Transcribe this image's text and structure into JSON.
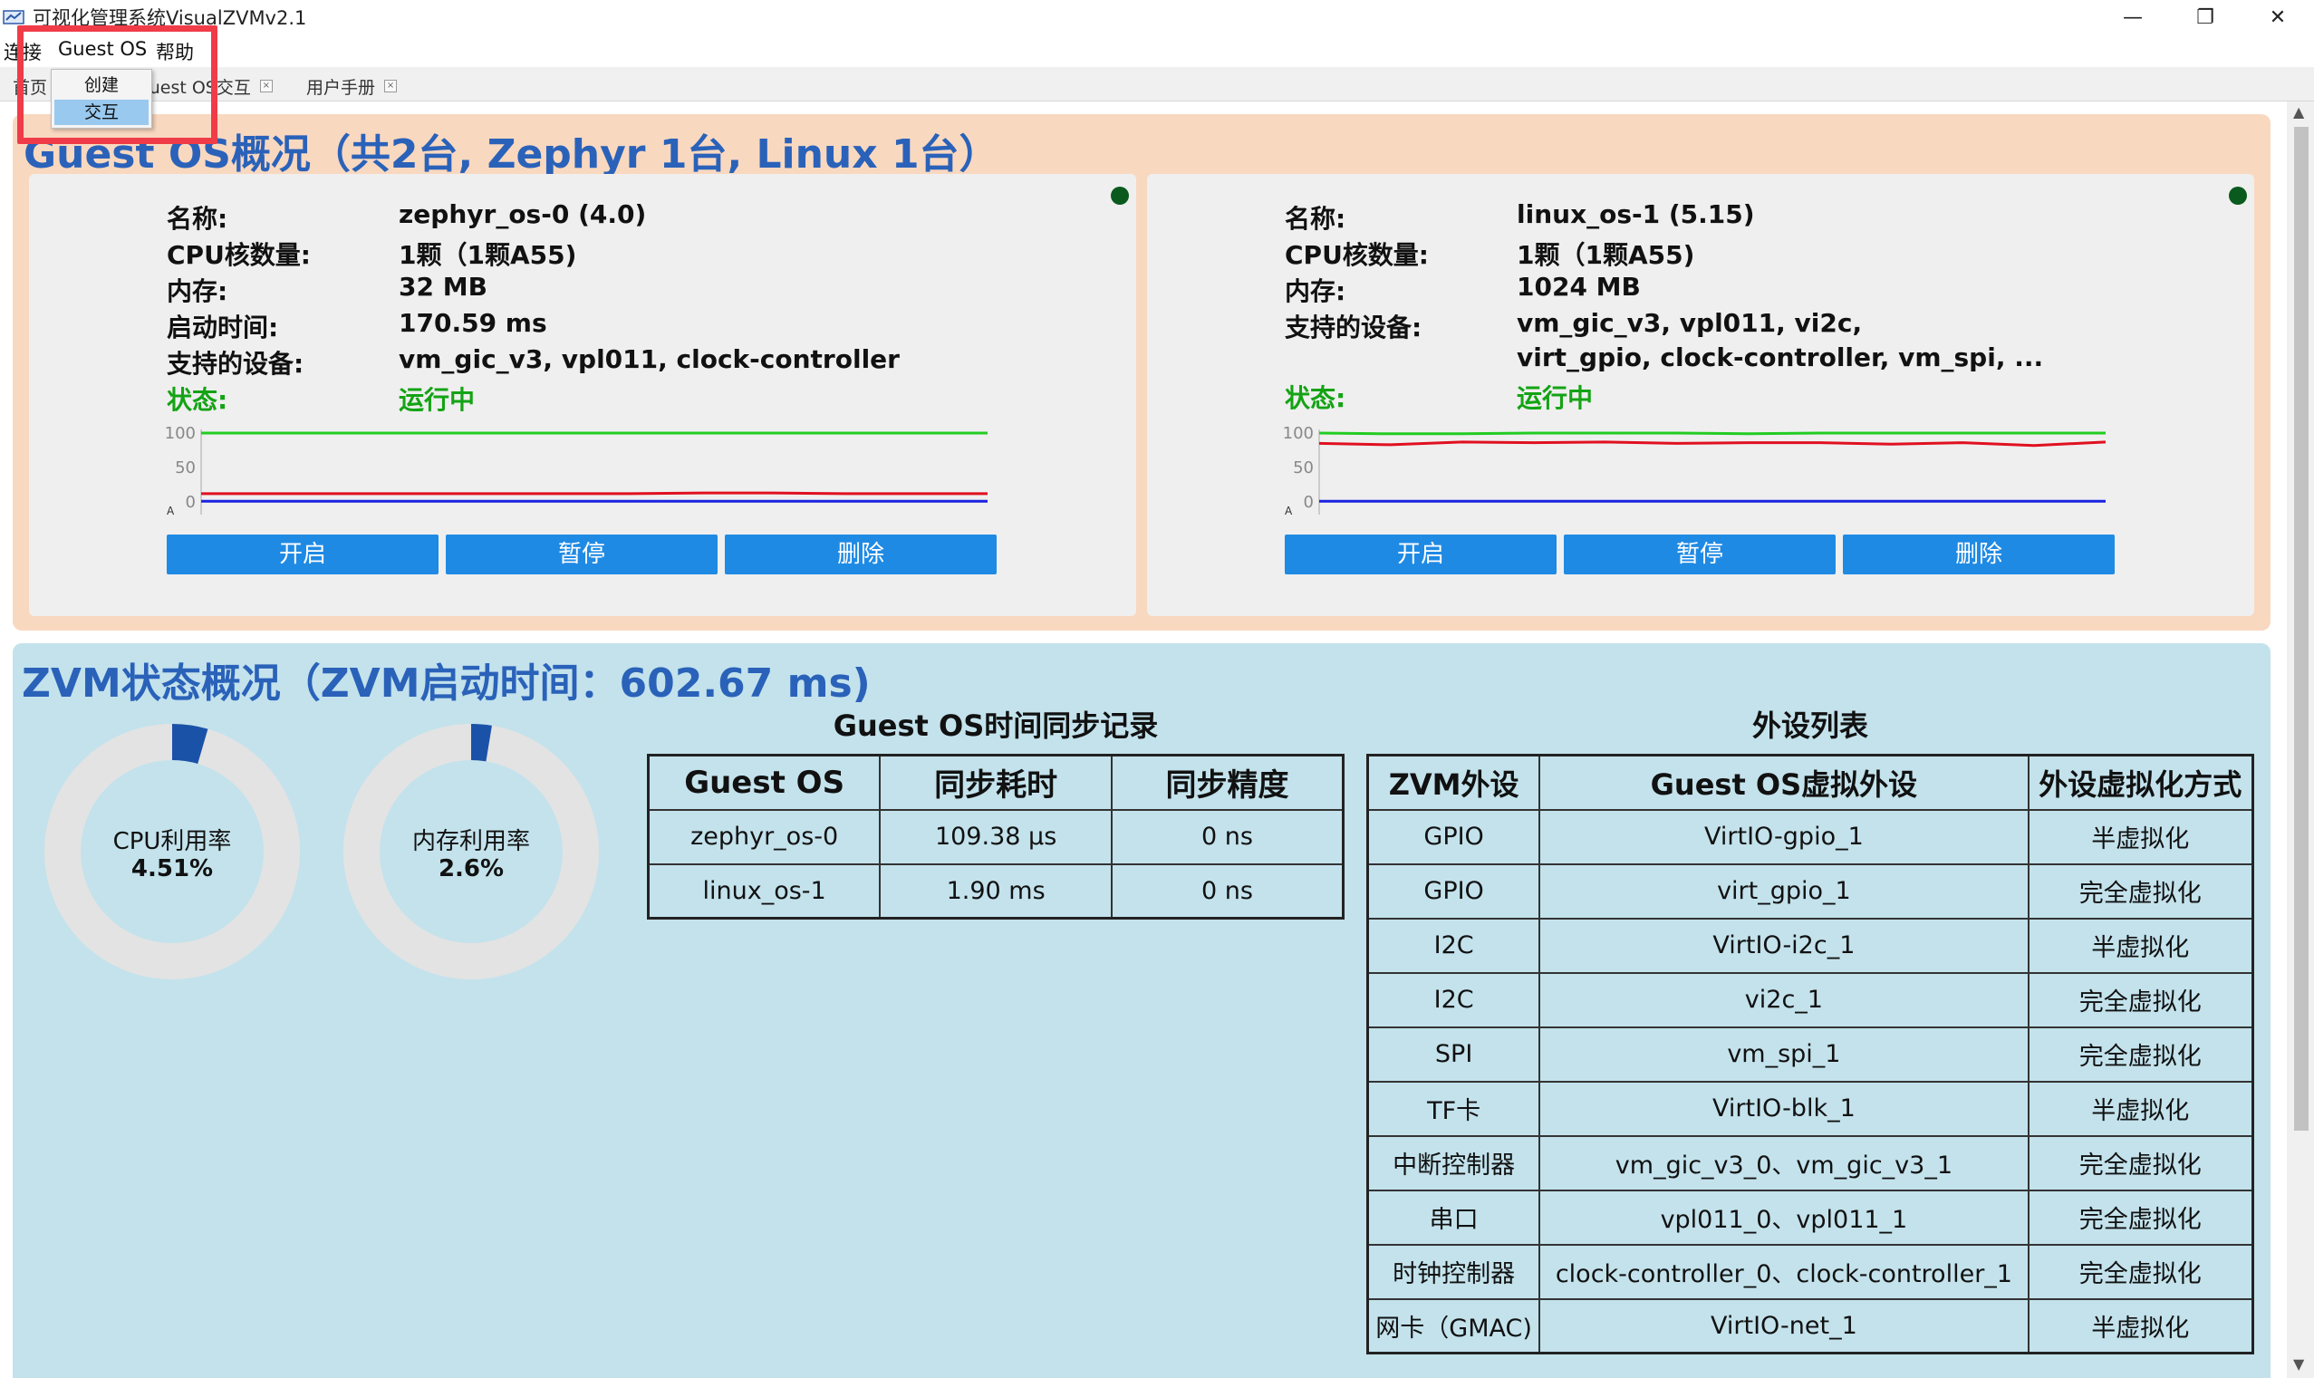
{
  "window": {
    "title": "可视化管理系统VisualZVMv2.1",
    "minimize_glyph": "—",
    "restore_glyph": "❐",
    "close_glyph": "✕"
  },
  "menubar": {
    "items": [
      {
        "label": "连接"
      },
      {
        "label": "Guest OS"
      },
      {
        "label": "帮助"
      }
    ]
  },
  "tabs": [
    {
      "label": "首页"
    },
    {
      "label": "Guest OS交互"
    },
    {
      "label": "用户手册"
    }
  ],
  "tab_close_glyph": "×",
  "dropdown": {
    "items": [
      {
        "label": "创建",
        "selected": false
      },
      {
        "label": "交互",
        "selected": true
      }
    ]
  },
  "guest_section": {
    "title": "Guest OS概况（共2台, Zephyr 1台, Linux 1台）",
    "field_labels": {
      "name": "名称:",
      "cpu": "CPU核数量:",
      "memory": "内存:",
      "boot_time": "启动时间:",
      "devices": "支持的设备:",
      "status": "状态:"
    },
    "buttons": {
      "start": "开启",
      "pause": "暂停",
      "delete": "删除"
    },
    "chart_axis": {
      "y_ticks": [
        "100",
        "50",
        "0"
      ],
      "corner_label": "A"
    },
    "cards": [
      {
        "name": "zephyr_os-0 (4.0)",
        "cpu": "1颗（1颗A55)",
        "memory": "32 MB",
        "boot_time": "170.59 ms",
        "devices_line1": "vm_gic_v3, vpl011, clock-controller",
        "devices_line2": "",
        "status": "运行中",
        "status_dot_color": "#0a5a1e"
      },
      {
        "name": "linux_os-1 (5.15)",
        "cpu": "1颗（1颗A55)",
        "memory": "1024 MB",
        "boot_time": "",
        "devices_line1": "vm_gic_v3, vpl011, vi2c,",
        "devices_line2": "virt_gpio, clock-controller, vm_spi, ...",
        "status": "运行中",
        "status_dot_color": "#0a5a1e"
      }
    ]
  },
  "chart_data": [
    {
      "type": "line",
      "y_ticks": [
        "100",
        "50",
        "0"
      ],
      "ylim": [
        0,
        100
      ],
      "series": [
        {
          "color": "#22cc22",
          "values": [
            100,
            100,
            100,
            100,
            100,
            100,
            100,
            100,
            100,
            100,
            100,
            100
          ]
        },
        {
          "color": "#e01020",
          "values": [
            12,
            12,
            12,
            12,
            12,
            12,
            12,
            13,
            13,
            12,
            12,
            12
          ]
        },
        {
          "color": "#1a22e0",
          "values": [
            1,
            1,
            1,
            1,
            1,
            1,
            1,
            1,
            1,
            1,
            1,
            1
          ]
        }
      ]
    },
    {
      "type": "line",
      "y_ticks": [
        "100",
        "50",
        "0"
      ],
      "ylim": [
        0,
        100
      ],
      "series": [
        {
          "color": "#22cc22",
          "values": [
            100,
            99,
            99,
            100,
            100,
            100,
            99,
            100,
            100,
            100,
            100,
            100
          ]
        },
        {
          "color": "#e01020",
          "values": [
            85,
            83,
            87,
            86,
            87,
            85,
            86,
            86,
            84,
            86,
            82,
            87
          ]
        },
        {
          "color": "#1a22e0",
          "values": [
            1,
            1,
            1,
            1,
            1,
            1,
            1,
            1,
            1,
            1,
            1,
            1
          ]
        }
      ]
    }
  ],
  "zvm_section": {
    "title": "ZVM状态概况（ZVM启动时间：602.67 ms)",
    "cpu_gauge": {
      "label": "CPU利用率",
      "value_text": "4.51%",
      "value": 4.51,
      "color": "#1a52a8"
    },
    "mem_gauge": {
      "label": "内存利用率",
      "value_text": "2.6%",
      "value": 2.6,
      "color": "#1a52a8"
    },
    "sync_table": {
      "caption": "Guest OS时间同步记录",
      "headers": [
        "Guest OS",
        "同步耗时",
        "同步精度"
      ],
      "rows": [
        [
          "zephyr_os-0",
          "109.38 μs",
          "0 ns"
        ],
        [
          "linux_os-1",
          "1.90 ms",
          "0 ns"
        ]
      ]
    },
    "device_table": {
      "caption": "外设列表",
      "headers": [
        "ZVM外设",
        "Guest OS虚拟外设",
        "外设虚拟化方式"
      ],
      "rows": [
        [
          "GPIO",
          "VirtIO-gpio_1",
          "半虚拟化"
        ],
        [
          "GPIO",
          "virt_gpio_1",
          "完全虚拟化"
        ],
        [
          "I2C",
          "VirtIO-i2c_1",
          "半虚拟化"
        ],
        [
          "I2C",
          "vi2c_1",
          "完全虚拟化"
        ],
        [
          "SPI",
          "vm_spi_1",
          "完全虚拟化"
        ],
        [
          "TF卡",
          "VirtIO-blk_1",
          "半虚拟化"
        ],
        [
          "中断控制器",
          "vm_gic_v3_0、vm_gic_v3_1",
          "完全虚拟化"
        ],
        [
          "串口",
          "vpl011_0、vpl011_1",
          "完全虚拟化"
        ],
        [
          "时钟控制器",
          "clock-controller_0、clock-controller_1",
          "完全虚拟化"
        ],
        [
          "网卡（GMAC)",
          "VirtIO-net_1",
          "半虚拟化"
        ]
      ]
    }
  },
  "scrollbar": {
    "up_glyph": "▲",
    "down_glyph": "▼"
  }
}
